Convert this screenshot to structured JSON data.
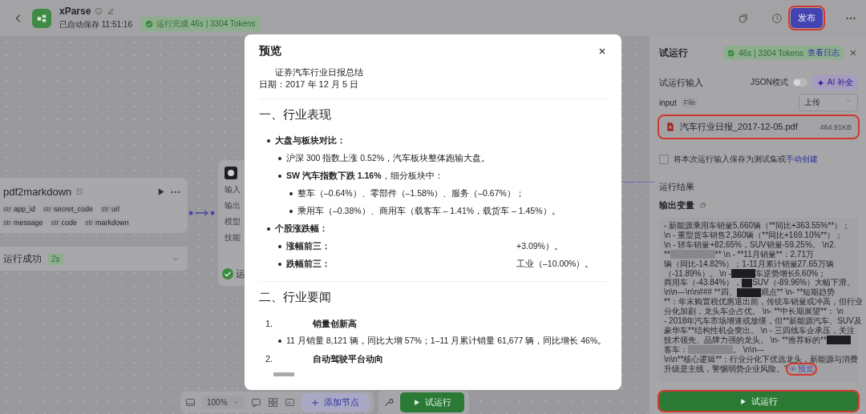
{
  "header": {
    "title": "xParse",
    "autosave": "已自动保存 11:51:16",
    "run_status": "运行完成 46s | 3304 Tokens",
    "publish": {
      "label": "发布",
      "highlighted": true
    }
  },
  "canvas": {
    "node": {
      "title": "pdf2markdown",
      "inputs": [
        {
          "type": "str",
          "name": "app_id"
        },
        {
          "type": "str",
          "name": "secret_code"
        },
        {
          "type": "str",
          "name": "url"
        }
      ],
      "outputs": [
        {
          "type": "str",
          "name": "message"
        },
        {
          "type": "str",
          "name": "code"
        },
        {
          "type": "str",
          "name": "markdown"
        }
      ]
    },
    "status": {
      "label": "运行成功",
      "duration": "2s"
    },
    "agent_node": {
      "rows": [
        "输入",
        "输出",
        "模型",
        "技能"
      ],
      "status": "运"
    }
  },
  "toolbar": {
    "zoom": "100%",
    "add_node": "添加节点",
    "run": "试运行"
  },
  "preview_modal": {
    "title": "预览",
    "blocks": [
      {
        "kind": "subtitle",
        "text": "证券汽车行业日报总结"
      },
      {
        "kind": "line",
        "text": "日期：2017 年 12 月 5 日"
      },
      {
        "kind": "divider"
      },
      {
        "kind": "heading",
        "text": "一、行业表现"
      },
      {
        "kind": "list",
        "items": [
          {
            "text": "大盘与板块对比：",
            "children": [
              {
                "text": "沪深 300 指数上涨 0.52%，汽车板块整体跑输大盘。"
              },
              {
                "text": "**SW 汽车指数下跌 1.16%**，细分板块中：",
                "children": [
                  {
                    "text": "整车（–0.64%）、零部件（–1.58%）、服务（–0.67%）；"
                  },
                  {
                    "text": "乘用车（–0.38%）、商用车（载客车 – 1.41%，载货车 – 1.45%）。"
                  }
                ]
              }
            ]
          },
          {
            "text": "个股涨跌幅：",
            "children": [
              {
                "text": "涨幅前三：",
                "value": "+3.09%）。"
              },
              {
                "text": "跌幅前三：",
                "value": "工业（–10.00%）。"
              }
            ]
          }
        ]
      },
      {
        "kind": "divider"
      },
      {
        "kind": "heading",
        "text": "二、行业要闻"
      },
      {
        "kind": "ordered",
        "items": [
          {
            "number": "1.",
            "text": "销量创新高",
            "children": [
              {
                "text": "11 月销量 8,121 辆，同比大增 57%；1–11 月累计销量 61,677 辆，同比增长 46%。"
              }
            ]
          },
          {
            "number": "2.",
            "text": "自动驾驶平台动向"
          }
        ]
      }
    ]
  },
  "test_panel": {
    "title": "试运行",
    "run_info": "46s | 3304 Tokens",
    "log_link": "查看日志",
    "input_title": "试运行输入",
    "json_mode": {
      "label": "JSON模式",
      "on": false
    },
    "ai_button": "AI 补全",
    "input_label": "input",
    "input_type": "File",
    "upload": "上传",
    "file": {
      "name": "汽车行业日报_2017-12-05.pdf",
      "size": "464.91KB",
      "highlighted": true
    },
    "save_option": {
      "checked": false,
      "text": "将本次运行输入保存为测试集或",
      "link": "手动创建"
    },
    "result_title": "运行结果",
    "output_title": "输出变量",
    "output_lines": [
      [
        {
          "kind": "text",
          "text": "- 新能源乘用车销量5,660辆（**同比+363.55%**）；"
        }
      ],
      [
        {
          "kind": "text",
          "text": "\\n    - 重型货车销售2,360辆（**同比+169.10%**）；"
        }
      ],
      [
        {
          "kind": "text",
          "text": "\\n    - 轿车销量+82.65%，SUV销量-59.25%。  \\n2."
        }
      ],
      [
        {
          "kind": "text",
          "text": "**"
        },
        {
          "kind": "blur"
        },
        {
          "kind": "text",
          "text": "**  \\n  - **11月销量**：2.71万"
        }
      ],
      [
        {
          "kind": "text",
          "text": "辆（同比-14.82%）；1-11月累计销量27.65万辆"
        }
      ],
      [
        {
          "kind": "text",
          "text": "（-11.89%）。 \\n   -"
        },
        {
          "kind": "redaction"
        },
        {
          "kind": "text",
          "text": "车逆势增长6.60%；"
        }
      ],
      [
        {
          "kind": "text",
          "text": "商用车（-43.84%），"
        },
        {
          "kind": "redaction"
        },
        {
          "kind": "text",
          "text": "SUV（-89.96%）大幅下滑。"
        }
      ],
      [
        {
          "kind": "text",
          "text": "\\n\\n---\\n\\n### **四、"
        },
        {
          "kind": "redaction"
        },
        {
          "kind": "text",
          "text": "观点**  \\n- **短期趋势"
        }
      ],
      [
        {
          "kind": "text",
          "text": "**：年末购置税优惠退出前，传统车销量或冲高，但行业"
        }
      ],
      [
        {
          "kind": "text",
          "text": "分化加剧，龙头车企占优。 \\n- **中长期展望**： \\n"
        }
      ],
      [
        {
          "kind": "text",
          "text": "- 2018年汽车市场增速或放缓，但**新能源汽车、SUV及"
        }
      ],
      [
        {
          "kind": "text",
          "text": "豪华车**结构性机会突出。 \\n - 三四线车企承压，关注"
        }
      ],
      [
        {
          "kind": "text",
          "text": "技术领先、品牌力强的龙头。 \\n- **推荐标的**"
        },
        {
          "kind": "redaction"
        }
      ],
      [
        {
          "kind": "text",
          "text": "客车："
        },
        {
          "kind": "blur"
        },
        {
          "kind": "text",
          "text": "。  \\n\\n---"
        }
      ],
      [
        {
          "kind": "text",
          "text": "\\n\\n**核心逻辑**：行业分化下优选龙头，新能源与消费"
        }
      ],
      [
        {
          "kind": "text",
          "text": "升级是主线，警惕弱势企业风险。\""
        }
      ]
    ],
    "preview_link": {
      "label": "预览",
      "highlighted": true
    },
    "run_button": {
      "label": "试运行",
      "highlighted": true
    }
  }
}
